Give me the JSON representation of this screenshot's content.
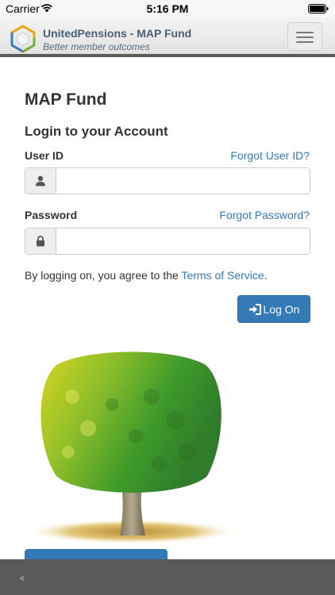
{
  "status_bar": {
    "carrier": "Carrier",
    "time": "5:16 PM"
  },
  "header": {
    "brand_title": "UnitedPensions - MAP Fund",
    "brand_tagline": "Better member outcomes",
    "logo_icon": "hexagon-cube-logo",
    "menu_icon": "hamburger-menu-icon"
  },
  "main": {
    "page_title": "MAP Fund",
    "form_heading": "Login to your Account",
    "user_id": {
      "label": "User ID",
      "forgot_link": "Forgot User ID?",
      "value": "",
      "icon": "user-icon"
    },
    "password": {
      "label": "Password",
      "forgot_link": "Forgot Password?",
      "value": "",
      "icon": "lock-icon"
    },
    "terms": {
      "prefix": "By logging on, you agree to the ",
      "link": "Terms of Service",
      "suffix": "."
    },
    "logon_button": {
      "label": "Log On",
      "icon": "sign-in-icon"
    }
  },
  "colors": {
    "accent": "#337ab7",
    "header_border": "#5b5b5b",
    "toolbar": "#5a5a5a"
  }
}
